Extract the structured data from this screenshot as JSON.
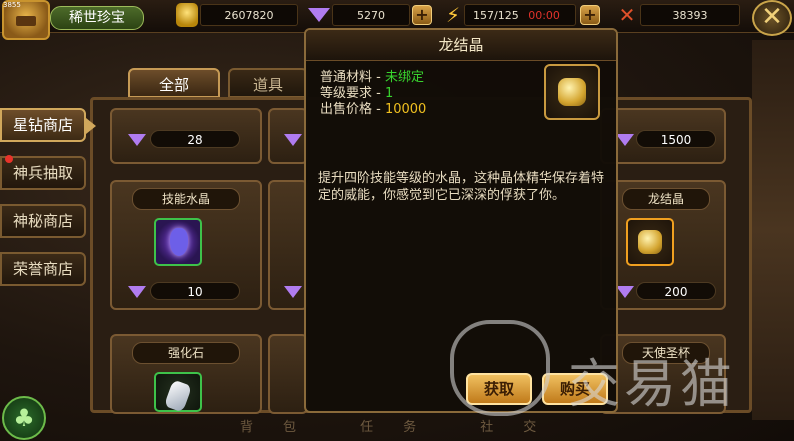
{
  "topbar": {
    "version": "3855",
    "shop_title": "稀世珍宝",
    "gold": "2607820",
    "diamonds": "5270",
    "stamina": "157/125",
    "timer": "00:00",
    "power": "38393",
    "close_icon": "close-x-icon"
  },
  "tabs": [
    {
      "label": "全部",
      "active": true
    },
    {
      "label": "道具",
      "active": false
    }
  ],
  "side_menu": [
    {
      "label": "星钻商店",
      "active": true,
      "badge": false
    },
    {
      "label": "神兵抽取",
      "active": false,
      "badge": true
    },
    {
      "label": "神秘商店",
      "active": false,
      "badge": false
    },
    {
      "label": "荣誉商店",
      "active": false,
      "badge": false
    }
  ],
  "cards": [
    {
      "title": "",
      "price": "28"
    },
    {
      "title": "技能水晶",
      "price": "10",
      "icon": "skill-crystal-icon"
    },
    {
      "title": "强化石",
      "price": "",
      "icon": "enhance-stone-icon"
    },
    {
      "title": "",
      "price": "1500"
    },
    {
      "title": "龙结晶",
      "price": "200",
      "icon": "dragon-crystal-icon"
    },
    {
      "title": "天使圣杯",
      "price": ""
    }
  ],
  "tooltip": {
    "title": "龙结晶",
    "material_label": "普通材料 - ",
    "material_value": "未绑定",
    "level_label": "等级要求 - ",
    "level_value": "1",
    "sell_label": "出售价格 - ",
    "sell_value": "10000",
    "description": "提升四阶技能等级的水晶，这种晶体精华保存着特定的威能，你感觉到它已深深的俘获了你。",
    "btn_get": "获取",
    "btn_buy": "购买"
  },
  "bottom_nav": "背包 任务 社交",
  "watermark": "交易猫",
  "colors": {
    "accent_green": "#38d32e",
    "accent_yellow": "#f0c020",
    "timer_red": "#e0322a",
    "frame_gold": "#8a6a3a"
  }
}
